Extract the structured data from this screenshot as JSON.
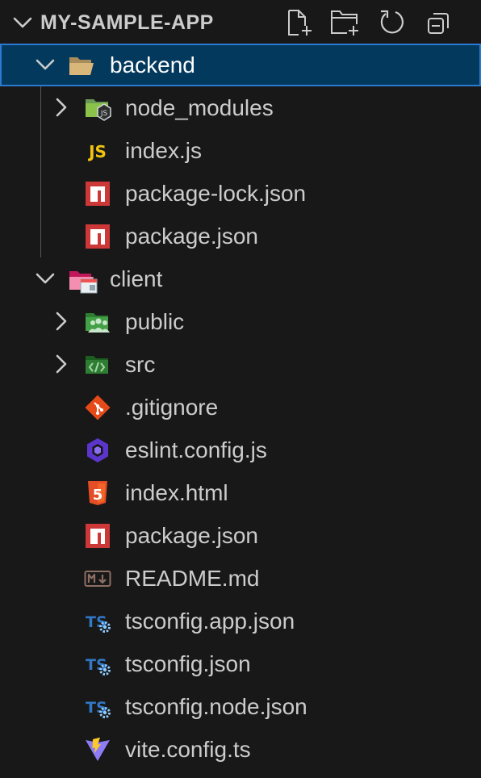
{
  "explorer": {
    "title": "MY-SAMPLE-APP",
    "actions": [
      {
        "name": "new-file-button",
        "icon": "new-file-icon"
      },
      {
        "name": "new-folder-button",
        "icon": "new-folder-icon"
      },
      {
        "name": "refresh-button",
        "icon": "refresh-icon"
      },
      {
        "name": "collapse-all-button",
        "icon": "collapse-all-icon"
      }
    ],
    "selected_color": "#04395e",
    "focus_border_color": "#2b79d0"
  },
  "tree": {
    "backend": {
      "label": "backend",
      "expanded": true,
      "icon": "folder-open-icon",
      "children": {
        "node_modules": {
          "label": "node_modules",
          "expanded": false,
          "icon": "nodejs-folder-icon"
        },
        "index_js": {
          "label": "index.js",
          "icon": "javascript-icon"
        },
        "package_lock": {
          "label": "package-lock.json",
          "icon": "npm-icon"
        },
        "package_json": {
          "label": "package.json",
          "icon": "npm-icon"
        }
      }
    },
    "client": {
      "label": "client",
      "expanded": true,
      "icon": "client-folder-icon",
      "children": {
        "public": {
          "label": "public",
          "expanded": false,
          "icon": "public-folder-icon"
        },
        "src": {
          "label": "src",
          "expanded": false,
          "icon": "src-folder-icon"
        },
        "gitignore": {
          "label": ".gitignore",
          "icon": "git-icon"
        },
        "eslint": {
          "label": "eslint.config.js",
          "icon": "eslint-icon"
        },
        "index_html": {
          "label": "index.html",
          "icon": "html5-icon"
        },
        "package_json": {
          "label": "package.json",
          "icon": "npm-icon"
        },
        "readme": {
          "label": "README.md",
          "icon": "markdown-icon"
        },
        "tsconfig_app": {
          "label": "tsconfig.app.json",
          "icon": "tsconfig-icon"
        },
        "tsconfig": {
          "label": "tsconfig.json",
          "icon": "tsconfig-icon"
        },
        "tsconfig_node": {
          "label": "tsconfig.node.json",
          "icon": "tsconfig-icon"
        },
        "vite_config": {
          "label": "vite.config.ts",
          "icon": "vite-icon"
        }
      }
    }
  }
}
